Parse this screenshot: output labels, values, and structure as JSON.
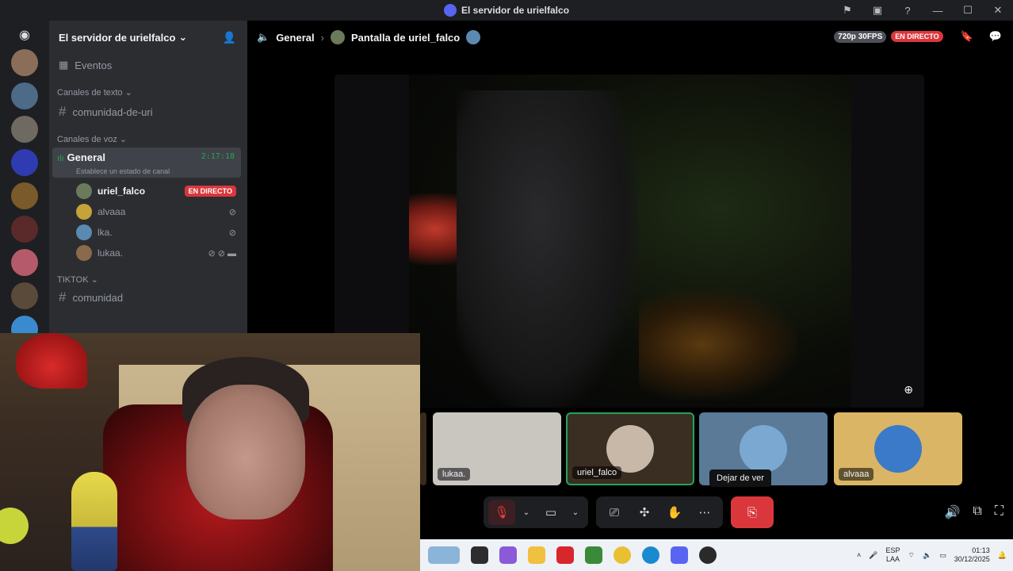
{
  "window": {
    "title": "El servidor de urielfalco"
  },
  "server": {
    "name": "El servidor de urielfalco"
  },
  "sidebar": {
    "events_label": "Eventos",
    "text_category": "Canales de texto",
    "text_channels": [
      "comunidad-de-uri"
    ],
    "voice_category": "Canales de voz",
    "voice_channel": {
      "name": "General",
      "timer": "2:17:18",
      "status": "Establece un estado de canal"
    },
    "voice_users": [
      {
        "name": "uriel_falco",
        "badge": "EN DIRECTO"
      },
      {
        "name": "alvaaa"
      },
      {
        "name": "lka."
      },
      {
        "name": "lukaa."
      }
    ],
    "tiktok_category": "TIKTOK",
    "tiktok_channel": "comunidad"
  },
  "header": {
    "channel": "General",
    "stream_title": "Pantalla de uriel_falco",
    "quality": "720p 30FPS",
    "live": "EN DIRECTO"
  },
  "tiles": [
    {
      "name": "lukaa."
    },
    {
      "name": "uriel_falco"
    },
    {
      "name": ""
    },
    {
      "name": "alvaaa"
    }
  ],
  "tooltip": "Dejar de ver",
  "taskbar": {
    "lang_top": "ESP",
    "lang_bottom": "LAA",
    "time": "01:13",
    "date": "30/12/2025"
  },
  "colors": {
    "live_red": "#da373c",
    "voice_green": "#23a55a",
    "blurple": "#5865f2"
  }
}
